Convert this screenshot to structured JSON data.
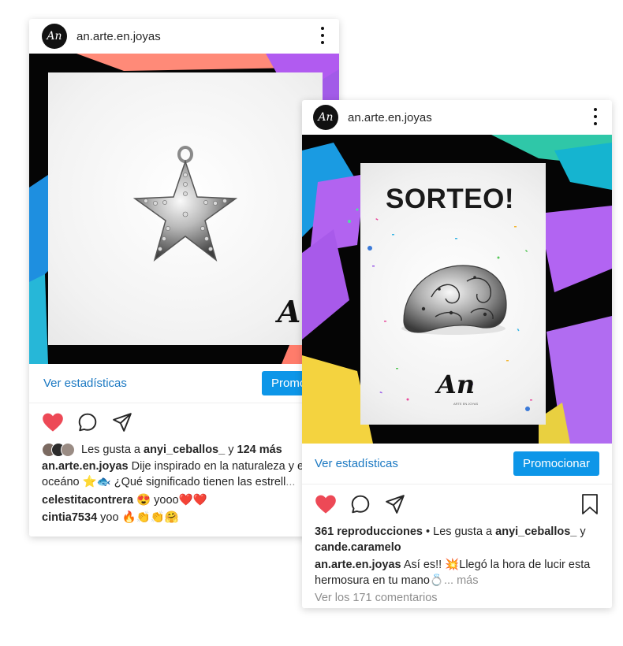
{
  "post1": {
    "avatar_text": "An",
    "username": "an.arte.en.joyas",
    "brand_sign": "An",
    "stats_link": "Ver estadísticas",
    "promote_label": "Promocionar",
    "likes_prefix": "Les gusta a",
    "likes_user": "anyi_ceballos_",
    "likes_join": "y",
    "likes_count": "124 más",
    "caption_user": "an.arte.en.joyas",
    "caption_text": "Dije inspirado en la naturaleza y e",
    "caption_line2": "oceáno ⭐🐟 ¿Qué significado tienen las estrell",
    "caption_more": "...",
    "comments": [
      {
        "user": "celestitacontrera",
        "text": "😍 yooo❤️❤️"
      },
      {
        "user": "cintia7534",
        "text": "yoo 🔥👏👏🤗"
      }
    ]
  },
  "post2": {
    "avatar_text": "An",
    "username": "an.arte.en.joyas",
    "sorteo_text": "SORTEO!",
    "brand_sign": "An",
    "brand_sub": "ARTE EN JOYAS",
    "stats_link": "Ver estadísticas",
    "promote_label": "Promocionar",
    "views": "361 reproducciones",
    "views_sep": "•",
    "likes_prefix": "Les gusta a",
    "likes_user": "anyi_ceballos_",
    "likes_join": "y",
    "likes_user2": "cande.caramelo",
    "caption_user": "an.arte.en.joyas",
    "caption_text": "Así es!! 💥Llegó la hora de lucir esta",
    "caption_line2": "hermosura en tu mano💍",
    "caption_more": "... más",
    "view_comments": "Ver los 171 comentarios"
  },
  "colors": {
    "accent_blue": "#0d96e8",
    "link_blue": "#1a78c2",
    "heart_red": "#ed4956",
    "muted_gray": "#8e8e8e"
  },
  "icons": [
    "more-vertical-icon",
    "heart-icon",
    "comment-icon",
    "share-icon",
    "bookmark-icon"
  ]
}
